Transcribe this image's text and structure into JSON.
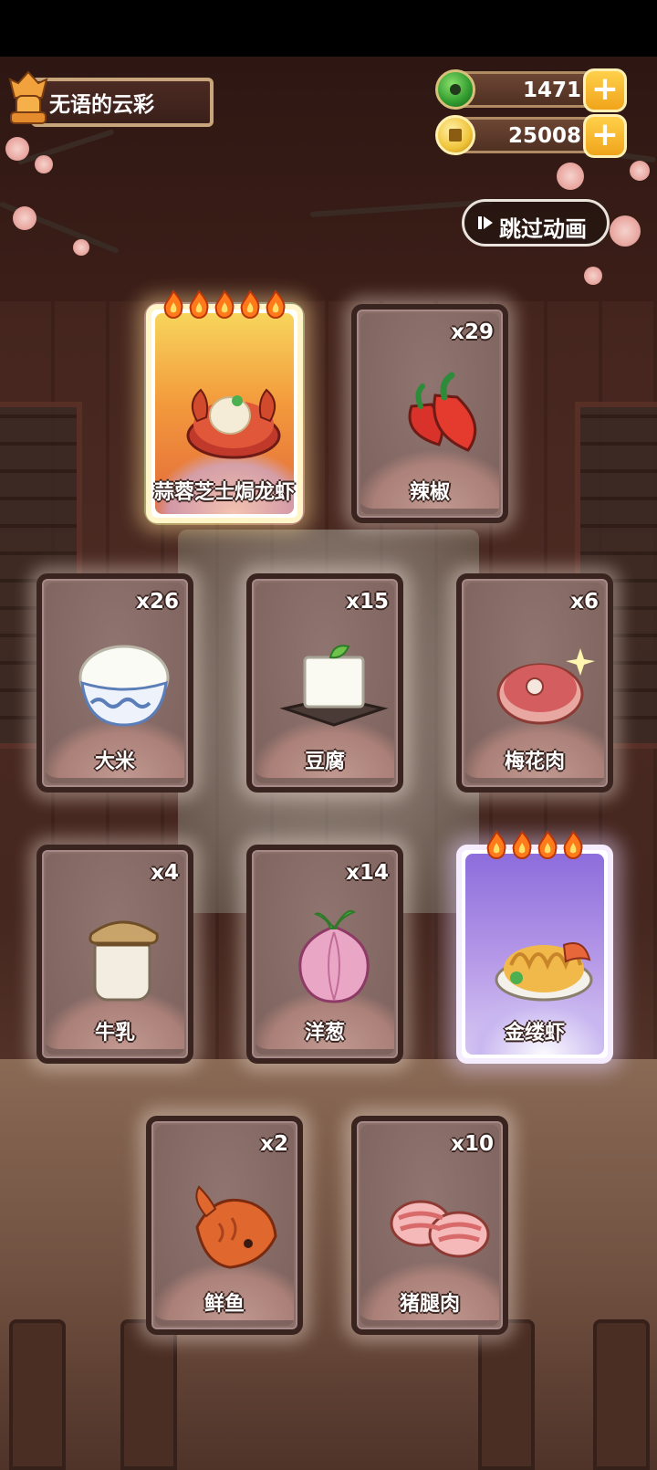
{
  "player": {
    "name": "无语的云彩"
  },
  "currencies": {
    "jade": {
      "value": "1471",
      "icon": "jade-icon",
      "color": "#2f9a2e"
    },
    "coins": {
      "value": "25008",
      "icon": "coin-icon",
      "color": "#f0c43a"
    },
    "plus_label": "+"
  },
  "skip": {
    "label": "跳过动画",
    "icon": "play-skip-icon"
  },
  "cards": [
    {
      "id": "lobster",
      "name": "蒜蓉芝士焗龙虾",
      "count": "",
      "rarity_flames": 5,
      "style": "gold",
      "icon": "lobster-dish-icon"
    },
    {
      "id": "chili",
      "name": "辣椒",
      "count": "x29",
      "icon": "chili-icon"
    },
    {
      "id": "rice",
      "name": "大米",
      "count": "x26",
      "icon": "rice-bowl-icon"
    },
    {
      "id": "tofu",
      "name": "豆腐",
      "count": "x15",
      "icon": "tofu-icon"
    },
    {
      "id": "pork",
      "name": "梅花肉",
      "count": "x6",
      "icon": "pork-shoulder-icon"
    },
    {
      "id": "milk",
      "name": "牛乳",
      "count": "x4",
      "icon": "milk-jar-icon"
    },
    {
      "id": "onion",
      "name": "洋葱",
      "count": "x14",
      "icon": "onion-icon"
    },
    {
      "id": "shrimp",
      "name": "金缕虾",
      "count": "",
      "rarity_flames": 4,
      "style": "purple",
      "icon": "golden-shrimp-icon"
    },
    {
      "id": "fish",
      "name": "鲜鱼",
      "count": "x2",
      "icon": "fish-icon"
    },
    {
      "id": "leg",
      "name": "猪腿肉",
      "count": "x10",
      "icon": "pork-leg-icon"
    }
  ]
}
